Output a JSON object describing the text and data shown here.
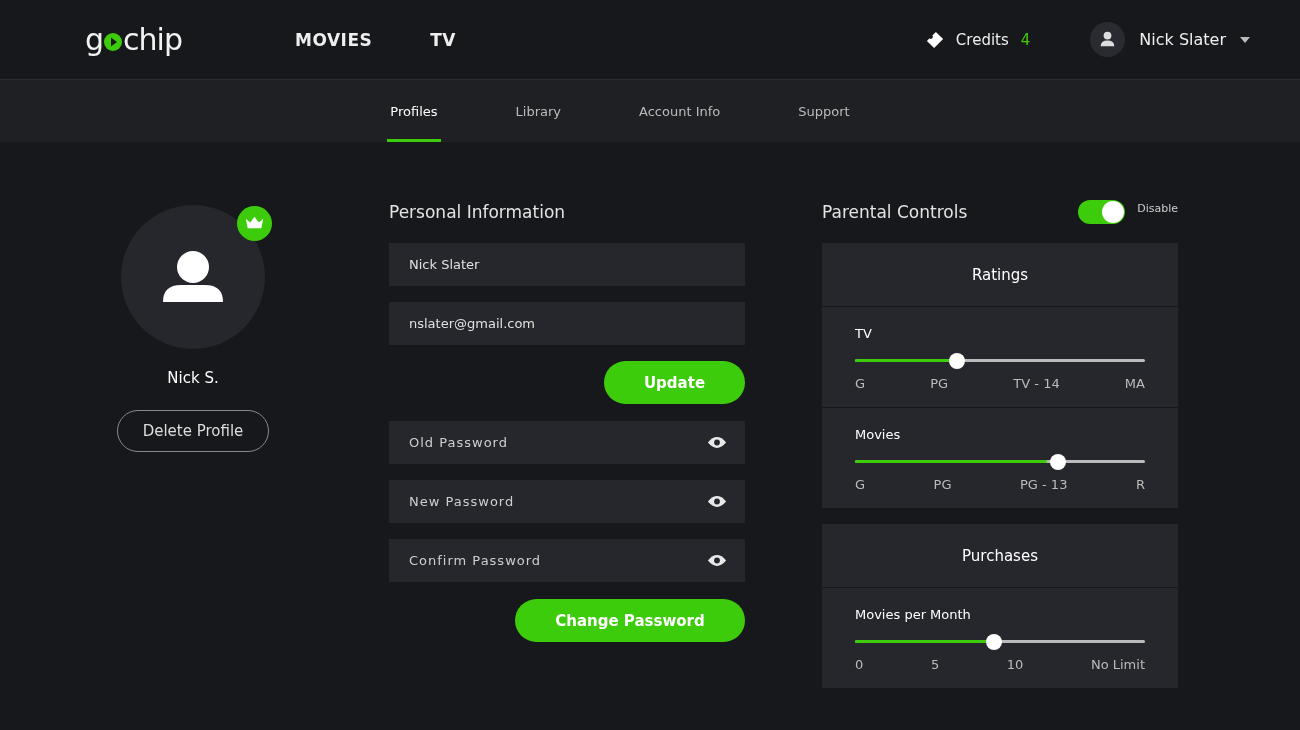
{
  "logo": {
    "before": "g",
    "after": "chip"
  },
  "nav": [
    {
      "label": "MOVIES",
      "selected": false
    },
    {
      "label": "TV",
      "selected": false
    }
  ],
  "credits": {
    "label": "Credits",
    "count": "4"
  },
  "user": {
    "name": "Nick Slater"
  },
  "tabs": [
    {
      "label": "Profiles",
      "selected": true
    },
    {
      "label": "Library",
      "selected": false
    },
    {
      "label": "Account Info",
      "selected": false
    },
    {
      "label": "Support",
      "selected": false
    }
  ],
  "profile": {
    "name": "Nick S.",
    "owner": true,
    "delete_label": "Delete Profile"
  },
  "personal": {
    "title": "Personal Information",
    "name_value": "Nick Slater",
    "email_value": "nslater@gmail.com",
    "update_label": "Update",
    "passwords": [
      {
        "placeholder": "Old Password"
      },
      {
        "placeholder": "New Password"
      },
      {
        "placeholder": "Confirm Password"
      }
    ],
    "change_label": "Change Password"
  },
  "parental": {
    "title": "Parental Controls",
    "on": true,
    "toggle_label": "Disable",
    "panels": [
      {
        "title": "Ratings",
        "sliders": [
          {
            "label": "TV",
            "level": 0.334,
            "ticks": [
              "G",
              "PG",
              "TV - 14",
              "MA"
            ]
          },
          {
            "label": "Movies",
            "level": 0.662,
            "ticks": [
              "G",
              "PG",
              "PG - 13",
              "R"
            ]
          }
        ]
      },
      {
        "title": "Purchases",
        "sliders": [
          {
            "label": "Movies per Month",
            "level": 0.455,
            "ticks": [
              "0",
              "5",
              "10",
              "No Limit"
            ]
          }
        ]
      }
    ]
  }
}
